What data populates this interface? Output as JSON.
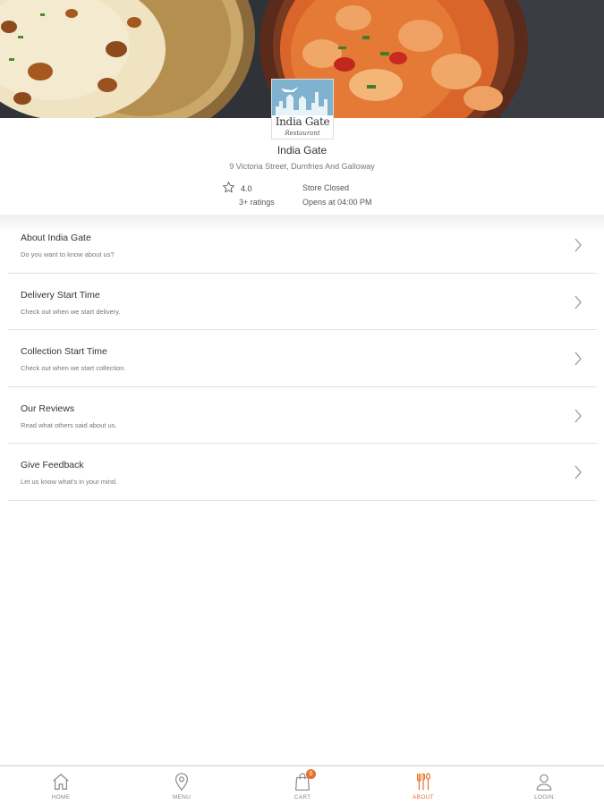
{
  "store": {
    "logo_name": "India Gate",
    "logo_subtitle": "Restaurant",
    "name": "India Gate",
    "address": "9 Victoria Street, Dumfries And Galloway",
    "rating": "4.0",
    "rating_count": "3+ ratings",
    "status": "Store Closed",
    "opens": "Opens at 04:00 PM"
  },
  "info_items": [
    {
      "title": "About India Gate",
      "subtitle": "Do you want to know about us?"
    },
    {
      "title": "Delivery Start Time",
      "subtitle": "Check out when we start delivery."
    },
    {
      "title": "Collection Start Time",
      "subtitle": "Check out when we start collection."
    },
    {
      "title": "Our Reviews",
      "subtitle": "Read what others said about us."
    },
    {
      "title": "Give Feedback",
      "subtitle": "Let us know what's in your mind."
    }
  ],
  "nav": {
    "home": "HOME",
    "menu": "MENU",
    "cart": "CART",
    "cart_count": "0",
    "about": "ABOUT",
    "login": "LOGIN"
  },
  "colors": {
    "accent": "#e8702a",
    "inactive": "#888888",
    "divider": "#e2e2e2"
  },
  "icons": {
    "rating": "star-icon",
    "row": "chevron-right-icon",
    "home": "home-icon",
    "menu": "location-pin-icon",
    "cart": "shopping-bag-icon",
    "about": "cutlery-icon",
    "login": "user-icon"
  }
}
